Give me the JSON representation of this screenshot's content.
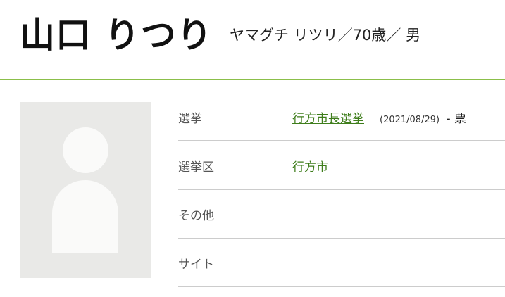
{
  "candidate": {
    "name": "山口 りつり",
    "kana": "ヤマグチ リツリ",
    "age": "70歳",
    "gender": "男",
    "separator": "／"
  },
  "info": {
    "election_label": "選挙",
    "election_value": "行方市長選挙",
    "election_date": "(2021/08/29)",
    "election_votes": "- 票",
    "district_label": "選挙区",
    "district_value": "行方市",
    "other_label": "その他",
    "site_label": "サイト"
  }
}
